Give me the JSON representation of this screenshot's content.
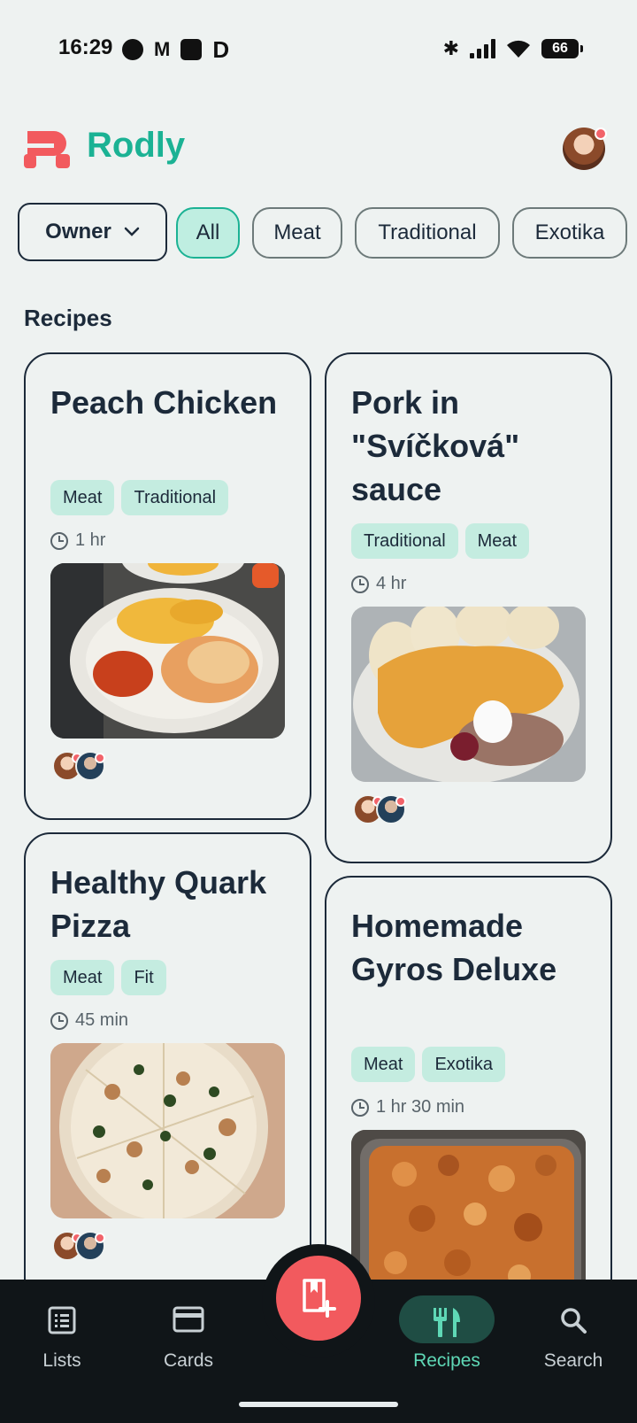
{
  "status_bar": {
    "time": "16:29",
    "battery": "66",
    "icons_left": [
      "notification-dot-icon",
      "gmail-icon",
      "app-square-icon",
      "d-app-icon"
    ],
    "icons_right": [
      "bluetooth-icon",
      "signal-icon",
      "wifi-icon",
      "battery-icon"
    ]
  },
  "header": {
    "app_name": "Rodly",
    "brand_color": "#1bb294",
    "logo_color": "#f25a5e"
  },
  "filters": {
    "owner_label": "Owner",
    "chips": [
      {
        "label": "All",
        "active": true
      },
      {
        "label": "Meat",
        "active": false
      },
      {
        "label": "Traditional",
        "active": false
      },
      {
        "label": "Exotika",
        "active": false
      }
    ]
  },
  "section_title": "Recipes",
  "recipes": [
    {
      "title": "Peach Chicken",
      "tags": [
        "Meat",
        "Traditional"
      ],
      "time": "1 hr",
      "photo": "peach-chicken-photo"
    },
    {
      "title": "Pork in \"Svíčková\" sauce",
      "tags": [
        "Traditional",
        "Meat"
      ],
      "time": "4 hr",
      "photo": "svickova-photo"
    },
    {
      "title": "Healthy Quark Pizza",
      "tags": [
        "Meat",
        "Fit"
      ],
      "time": "45 min",
      "photo": "quark-pizza-photo"
    },
    {
      "title": "Homemade Gyros Deluxe",
      "tags": [
        "Meat",
        "Exotika"
      ],
      "time": "1 hr 30 min",
      "photo": "gyros-photo"
    }
  ],
  "bottom_nav": {
    "items": [
      {
        "label": "Lists",
        "icon": "list-icon",
        "active": false
      },
      {
        "label": "Cards",
        "icon": "card-icon",
        "active": false
      },
      {
        "label": "Recipes",
        "icon": "fork-knife-icon",
        "active": true
      },
      {
        "label": "Search",
        "icon": "search-icon",
        "active": false
      }
    ],
    "fab_icon": "add-recipe-icon",
    "active_color": "#5fd8b6"
  }
}
